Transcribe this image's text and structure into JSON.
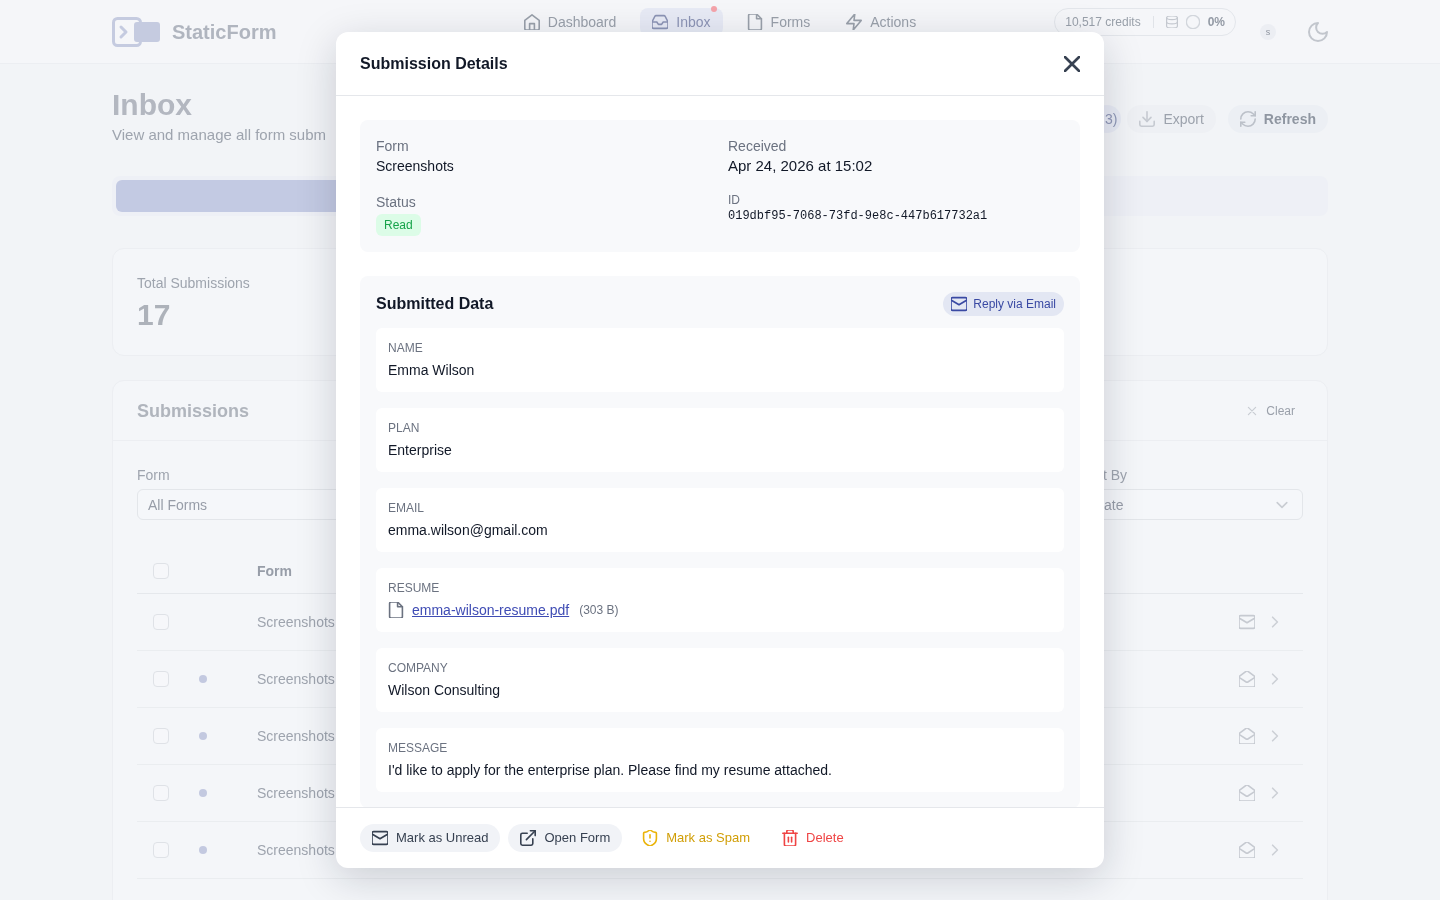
{
  "app": {
    "brand": "StaticForm",
    "nav": [
      {
        "label": "Dashboard",
        "selected": false,
        "badge": false
      },
      {
        "label": "Inbox",
        "selected": true,
        "badge": true
      },
      {
        "label": "Forms",
        "selected": false,
        "badge": false
      },
      {
        "label": "Actions",
        "selected": false,
        "badge": false
      }
    ],
    "credits": "10,517 credits",
    "usage": "0%",
    "avatar": "s"
  },
  "page": {
    "title": "Inbox",
    "subtitle": "View and manage all form subm",
    "actions": [
      {
        "kind": "count",
        "label": "3)"
      },
      {
        "kind": "export",
        "label": "Export"
      },
      {
        "kind": "refresh",
        "label": "Refresh"
      }
    ]
  },
  "stats": [
    {
      "label": "Total Submissions",
      "value": "17"
    }
  ],
  "submissions": {
    "title": "Submissions",
    "clear": "Clear",
    "filters": [
      {
        "label": "Form",
        "value": "All Forms"
      },
      {
        "label": "t By",
        "value": "ate"
      }
    ],
    "all_checked": false,
    "columns": [
      "Form"
    ],
    "rows": [
      {
        "form": "Screenshots",
        "checked": false,
        "unread": false
      },
      {
        "form": "Screenshots",
        "checked": false,
        "unread": true
      },
      {
        "form": "Screenshots",
        "checked": false,
        "unread": true
      },
      {
        "form": "Screenshots",
        "checked": false,
        "unread": true
      },
      {
        "form": "Screenshots",
        "checked": false,
        "unread": true
      }
    ]
  },
  "modal": {
    "title": "Submission Details",
    "details": [
      {
        "kind": "text",
        "label": "Form",
        "value": "Screenshots"
      },
      {
        "kind": "plain",
        "label": "Received",
        "value": "Apr 24, 2026 at 15:02"
      },
      {
        "kind": "badge",
        "label": "Status",
        "value": "Read"
      },
      {
        "kind": "code",
        "label": "ID",
        "value": "019dbf95-7068-73fd-9e8c-447b617732a1"
      }
    ],
    "data_title": "Submitted Data",
    "reply": "Reply via Email",
    "fields": [
      {
        "kind": "text",
        "label": "NAME",
        "value": "Emma Wilson"
      },
      {
        "kind": "text",
        "label": "PLAN",
        "value": "Enterprise"
      },
      {
        "kind": "text",
        "label": "EMAIL",
        "value": "emma.wilson@gmail.com"
      },
      {
        "kind": "file",
        "label": "RESUME",
        "value": "emma-wilson-resume.pdf",
        "size": "(303 B)"
      },
      {
        "kind": "text",
        "label": "COMPANY",
        "value": "Wilson Consulting"
      },
      {
        "kind": "text",
        "label": "MESSAGE",
        "value": "I'd like to apply for the enterprise plan. Please find my resume attached."
      }
    ],
    "actions": [
      {
        "kind": "unread",
        "label": "Mark as Unread"
      },
      {
        "kind": "open",
        "label": "Open Form"
      },
      {
        "kind": "spam",
        "label": "Mark as Spam"
      },
      {
        "kind": "delete",
        "label": "Delete"
      }
    ]
  }
}
